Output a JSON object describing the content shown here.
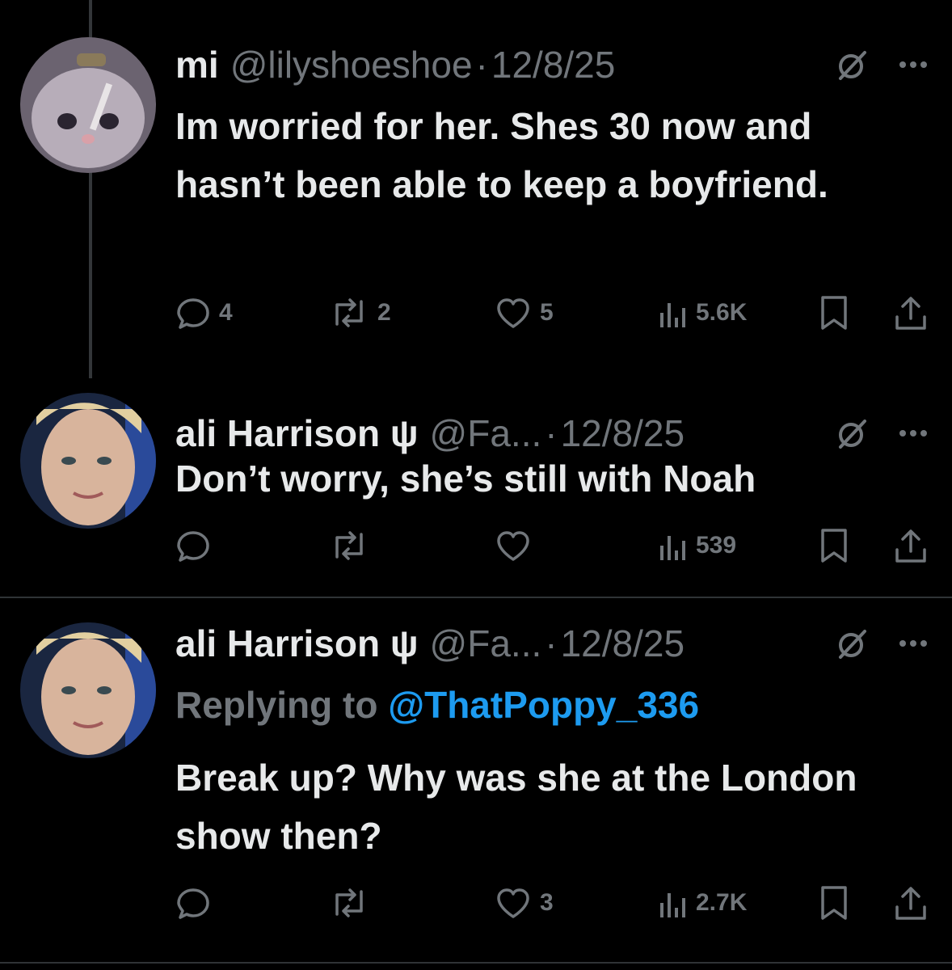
{
  "tweets": [
    {
      "name": "mi",
      "handle": "@lilyshoeshoe",
      "date": "12/8/25",
      "text": "Im worried for her. Shes 30 now and hasn’t been able to keep a boyfriend.",
      "reply_to_prefix": "",
      "reply_to_mention": "",
      "avatar": "cat-avatar",
      "stats": {
        "replies": "4",
        "reposts": "2",
        "likes": "5",
        "views": "5.6K"
      }
    },
    {
      "name": "ali Harrison ψ",
      "handle": "@Fa...",
      "date": "12/8/25",
      "text": "Don’t worry, she’s still with Noah",
      "reply_to_prefix": "",
      "reply_to_mention": "",
      "avatar": "woman-avatar",
      "stats": {
        "replies": "",
        "reposts": "",
        "likes": "",
        "views": "539"
      }
    },
    {
      "name": "ali Harrison ψ",
      "handle": "@Fa...",
      "date": "12/8/25",
      "text": "Break up? Why was she at the London show then?",
      "reply_to_prefix": "Replying to",
      "reply_to_mention": "@ThatPoppy_336",
      "avatar": "woman-avatar",
      "stats": {
        "replies": "",
        "reposts": "",
        "likes": "3",
        "views": "2.7K"
      }
    }
  ],
  "separator": "·",
  "icons": {
    "header": [
      "grok-icon",
      "more-icon"
    ],
    "actions": [
      "reply-icon",
      "repost-icon",
      "like-icon",
      "views-icon",
      "bookmark-icon",
      "share-icon"
    ]
  },
  "colors": {
    "background": "#000000",
    "text": "#e7e9ea",
    "muted": "#71767b",
    "link": "#1d9bf0"
  }
}
